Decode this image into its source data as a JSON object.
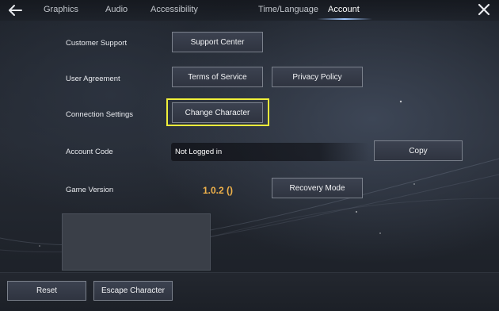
{
  "tabs": [
    {
      "label": "Graphics",
      "active": false
    },
    {
      "label": "Audio",
      "active": false
    },
    {
      "label": "Accessibility",
      "active": false
    },
    {
      "label": "Time/Language",
      "active": false
    },
    {
      "label": "Account",
      "active": true
    }
  ],
  "rows": {
    "support": {
      "label": "Customer Support",
      "button": "Support Center"
    },
    "agreement": {
      "label": "User Agreement",
      "terms_button": "Terms of Service",
      "privacy_button": "Privacy Policy"
    },
    "connection": {
      "label": "Connection Settings",
      "button": "Change Character"
    },
    "account_code": {
      "label": "Account Code",
      "value": "Not Logged in",
      "button": "Copy"
    },
    "version": {
      "label": "Game Version",
      "value": "1.0.2 ()",
      "button": "Recovery Mode"
    }
  },
  "footer": {
    "reset": "Reset",
    "escape": "Escape Character"
  },
  "colors": {
    "accent_highlight": "#f0f03a",
    "version_text": "#f0b24a",
    "active_tab_underline": "#9fc7ff"
  },
  "icons": {
    "back": "back-arrow-icon",
    "close": "close-icon"
  }
}
